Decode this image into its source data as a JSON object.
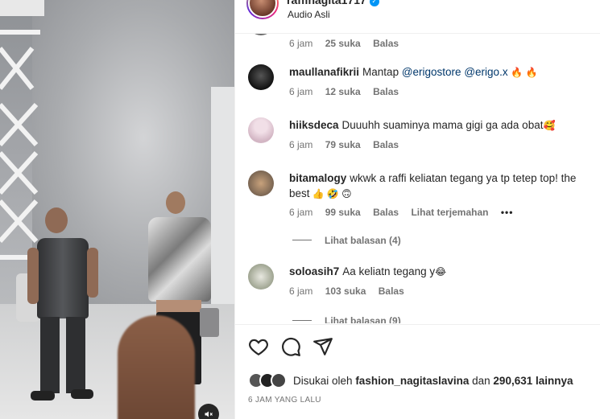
{
  "post": {
    "username": "raffinagita1717",
    "audio_label": "Audio Asli",
    "mute_icon": "speaker-muted-icon"
  },
  "comments": [
    {
      "username": "",
      "text": "",
      "time": "6 jam",
      "likes": "25 suka",
      "reply_label": "Balas"
    },
    {
      "username": "maullanafikrii",
      "text_pre": "Mantap ",
      "mention1": "@erigostore",
      "mention2": "@erigo.x",
      "emoji": "🔥 🔥",
      "time": "6 jam",
      "likes": "12 suka",
      "reply_label": "Balas"
    },
    {
      "username": "hiiksdeca",
      "text": "Duuuhh suaminya mama gigi ga ada obat",
      "emoji": "🥰",
      "time": "6 jam",
      "likes": "79 suka",
      "reply_label": "Balas"
    },
    {
      "username": "bitamalogy",
      "text": "wkwk a raffi keliatan tegang ya tp tetep top! the best",
      "emoji": "👍 🤣 🙃",
      "time": "6 jam",
      "likes": "99 suka",
      "reply_label": "Balas",
      "translate_label": "Lihat terjemahan",
      "more": "•••",
      "view_replies": "Lihat balasan (4)"
    },
    {
      "username": "soloasih7",
      "text": "Aa keliatn tegang y",
      "emoji": "😂",
      "time": "6 jam",
      "likes": "103 suka",
      "reply_label": "Balas",
      "view_replies": "Lihat balasan (9)"
    }
  ],
  "actions": {
    "like_icon": "heart-icon",
    "comment_icon": "comment-icon",
    "share_icon": "paper-plane-icon"
  },
  "likes": {
    "prefix": "Disukai oleh",
    "user": "fashion_nagitaslavina",
    "middle": "dan",
    "count": "290,631 lainnya"
  },
  "timestamp": "6 JAM YANG LALU",
  "colors": {
    "link": "#00376b",
    "verified": "#0095f6",
    "muted_text": "#737373"
  }
}
